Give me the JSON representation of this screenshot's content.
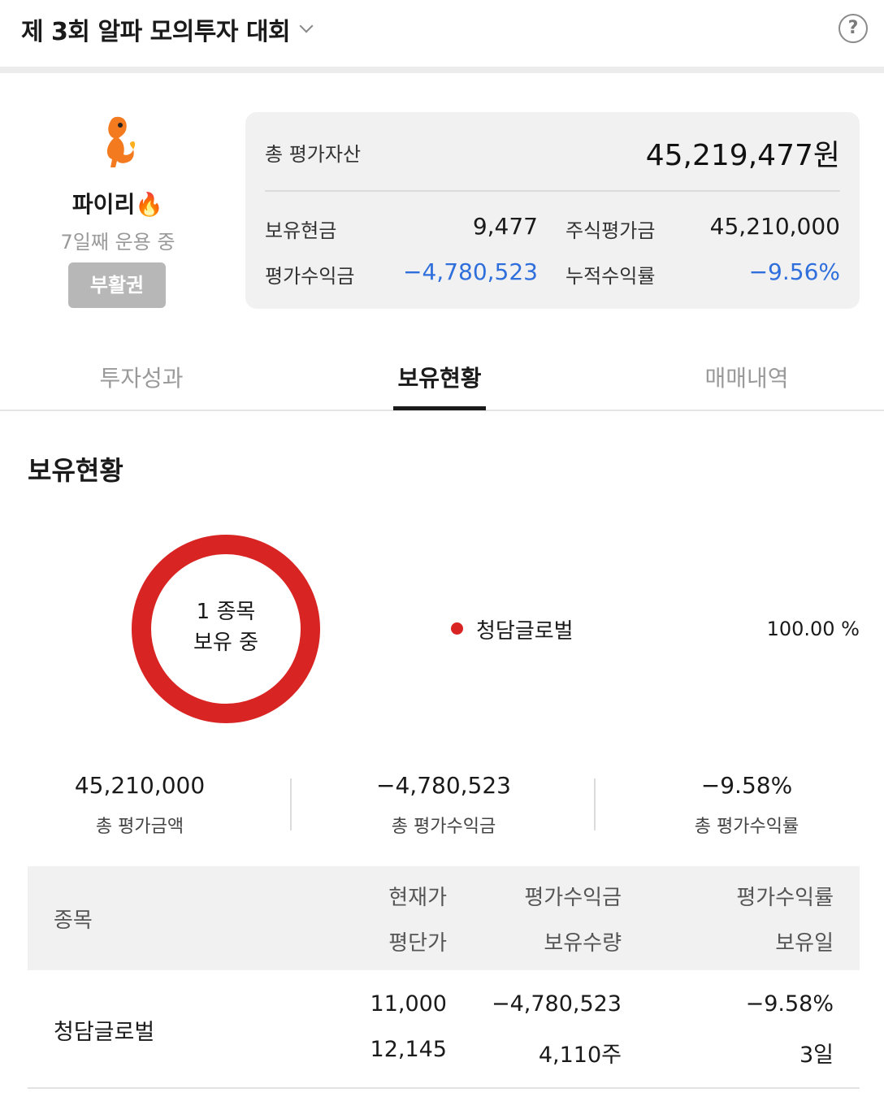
{
  "header": {
    "title": "제 3회 알파 모의투자 대회",
    "help_label": "?"
  },
  "profile": {
    "nickname": "파이리🔥",
    "days_label": "7일째 운용 중",
    "revive_button": "부활권"
  },
  "summary": {
    "total_label": "총 평가자산",
    "total_value": "45,219,477원",
    "cash_label": "보유현금",
    "cash_value": "9,477",
    "stock_label": "주식평가금",
    "stock_value": "45,210,000",
    "pnl_label": "평가수익금",
    "pnl_value": "−4,780,523",
    "return_label": "누적수익률",
    "return_value": "−9.56%"
  },
  "tabs": [
    {
      "label": "투자성과",
      "active": false
    },
    {
      "label": "보유현황",
      "active": true
    },
    {
      "label": "매매내역",
      "active": false
    }
  ],
  "holdings": {
    "section_title": "보유현황",
    "donut_line1": "1 종목",
    "donut_line2": "보유 중",
    "legend": [
      {
        "name": "청담글로벌",
        "percent": "100.00 %",
        "color": "#d92424"
      }
    ],
    "stats": [
      {
        "value": "45,210,000",
        "label": "총 평가금액"
      },
      {
        "value": "−4,780,523",
        "label": "총 평가수익금"
      },
      {
        "value": "−9.58%",
        "label": "총 평가수익률"
      }
    ],
    "table": {
      "headers": {
        "name": "종목",
        "current_price": "현재가",
        "avg_price": "평단가",
        "pnl": "평가수익금",
        "quantity": "보유수량",
        "return_rate": "평가수익률",
        "holding_days": "보유일"
      },
      "rows": [
        {
          "name": "청담글로벌",
          "current_price": "11,000",
          "avg_price": "12,145",
          "pnl": "−4,780,523",
          "quantity": "4,110주",
          "return_rate": "−9.58%",
          "holding_days": "3일"
        }
      ]
    }
  },
  "colors": {
    "negative": "#2f6fdc",
    "donut": "#d92424",
    "panel": "#f1f1f2"
  }
}
